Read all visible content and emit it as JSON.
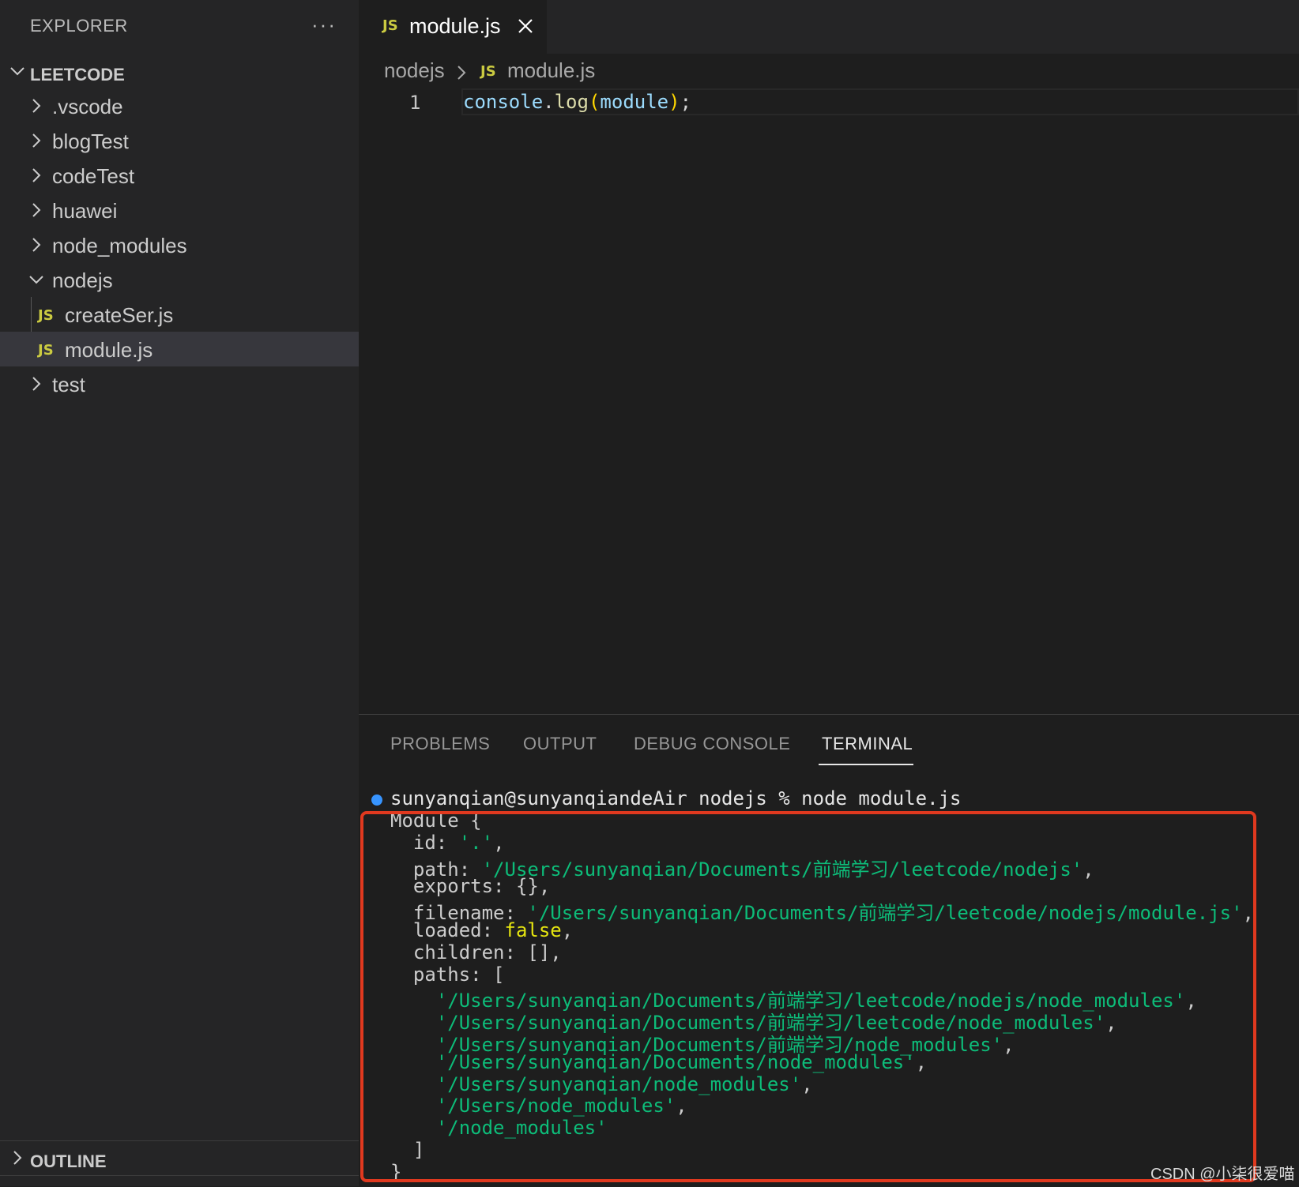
{
  "explorer": {
    "header": "EXPLORER",
    "more": "···",
    "root": "LEETCODE",
    "items": [
      {
        "label": ".vscode"
      },
      {
        "label": "blogTest"
      },
      {
        "label": "codeTest"
      },
      {
        "label": "huawei"
      },
      {
        "label": "node_modules"
      },
      {
        "label": "nodejs",
        "expanded": true
      },
      {
        "label": "createSer.js",
        "badge": "JS"
      },
      {
        "label": "module.js",
        "badge": "JS",
        "selected": true
      },
      {
        "label": "test"
      }
    ],
    "outline": "OUTLINE"
  },
  "editor": {
    "tab": {
      "badge": "JS",
      "label": "module.js"
    },
    "breadcrumb": {
      "folder": "nodejs",
      "badge": "JS",
      "file": "module.js"
    },
    "line_number": "1",
    "code": {
      "obj": "console",
      "dot": ".",
      "fn": "log",
      "open": "(",
      "arg": "module",
      "close": ")",
      "semi": ";"
    }
  },
  "panel": {
    "tabs": [
      "PROBLEMS",
      "OUTPUT",
      "DEBUG CONSOLE",
      "TERMINAL"
    ],
    "active_tab": "TERMINAL",
    "terminal": {
      "prompt": "sunyanqian@sunyanqiandeAir nodejs % node module.js",
      "lines": [
        {
          "text": "Module {"
        },
        {
          "key": "  id: ",
          "str": "'.'",
          "tail": ","
        },
        {
          "key": "  path: ",
          "str": "'/Users/sunyanqian/Documents/前端学习/leetcode/nodejs'",
          "tail": ","
        },
        {
          "text": "  exports: {},"
        },
        {
          "key": "  filename: ",
          "str": "'/Users/sunyanqian/Documents/前端学习/leetcode/nodejs/module.js'",
          "tail": ","
        },
        {
          "key": "  loaded: ",
          "bool": "false",
          "tail": ","
        },
        {
          "text": "  children: [],"
        },
        {
          "text": "  paths: ["
        },
        {
          "key": "    ",
          "str": "'/Users/sunyanqian/Documents/前端学习/leetcode/nodejs/node_modules'",
          "tail": ","
        },
        {
          "key": "    ",
          "str": "'/Users/sunyanqian/Documents/前端学习/leetcode/node_modules'",
          "tail": ","
        },
        {
          "key": "    ",
          "str": "'/Users/sunyanqian/Documents/前端学习/node_modules'",
          "tail": ","
        },
        {
          "key": "    ",
          "str": "'/Users/sunyanqian/Documents/node_modules'",
          "tail": ","
        },
        {
          "key": "    ",
          "str": "'/Users/sunyanqian/node_modules'",
          "tail": ","
        },
        {
          "key": "    ",
          "str": "'/Users/node_modules'",
          "tail": ","
        },
        {
          "key": "    ",
          "str": "'/node_modules'",
          "tail": ""
        },
        {
          "text": "  ]"
        },
        {
          "text": "}"
        }
      ]
    }
  },
  "watermark": "CSDN @小柒很爱喵",
  "colors": {
    "accent": "#3794ff",
    "highlight": "#e0391f",
    "string": "#0dbc79",
    "js_badge": "#cbcb41"
  }
}
